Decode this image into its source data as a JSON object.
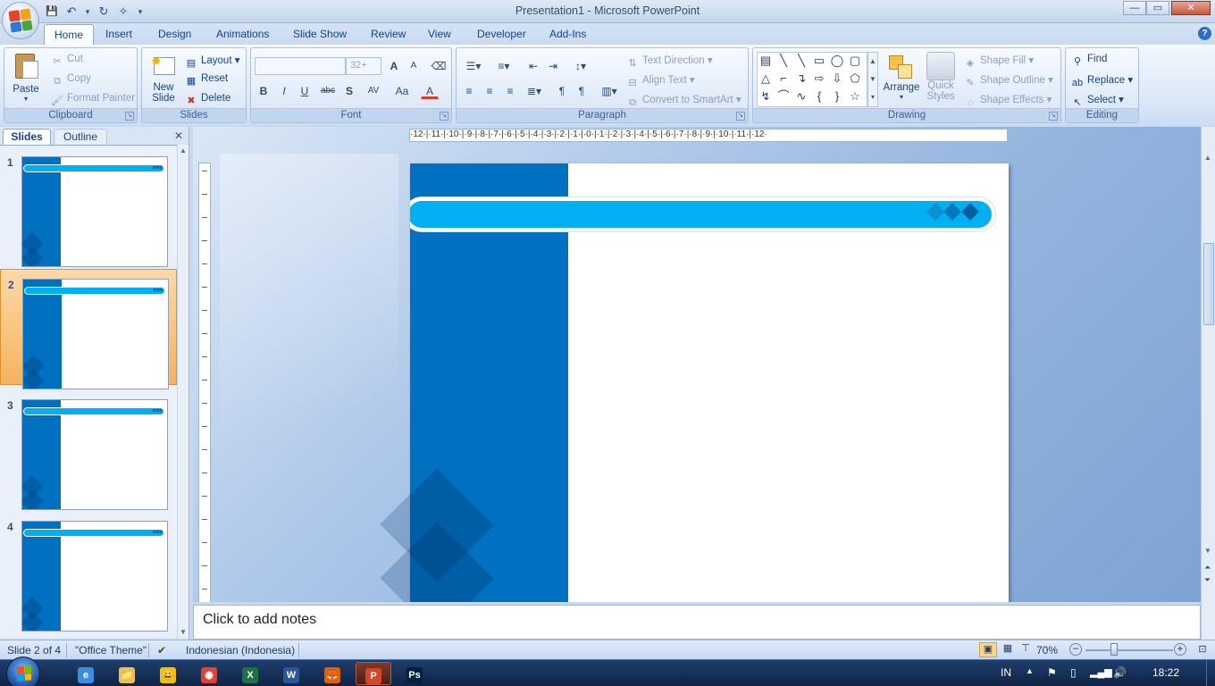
{
  "window": {
    "title": "Presentation1 - Microsoft PowerPoint",
    "minimize_glyph": "—",
    "maximize_glyph": "▭",
    "close_glyph": "✕"
  },
  "quick_access": {
    "save_glyph": "💾",
    "undo_glyph": "↶",
    "redo_glyph": "↻",
    "customize_glyph": "▾"
  },
  "tabs": [
    {
      "label": "Home",
      "active": true
    },
    {
      "label": "Insert"
    },
    {
      "label": "Design"
    },
    {
      "label": "Animations"
    },
    {
      "label": "Slide Show"
    },
    {
      "label": "Review"
    },
    {
      "label": "View"
    },
    {
      "label": "Developer"
    },
    {
      "label": "Add-Ins"
    }
  ],
  "help_glyph": "?",
  "ribbon": {
    "clipboard": {
      "label": "Clipboard",
      "paste": "Paste",
      "cut": "Cut",
      "copy": "Copy",
      "format_painter": "Format Painter"
    },
    "slides": {
      "label": "Slides",
      "new_slide_line1": "New",
      "new_slide_line2": "Slide",
      "layout": "Layout",
      "reset": "Reset",
      "delete": "Delete"
    },
    "font": {
      "label": "Font",
      "font_name": "",
      "font_size": "32+",
      "grow": "A",
      "shrink": "A",
      "bold": "B",
      "italic": "I",
      "underline": "U",
      "strike": "abc",
      "shadow": "S",
      "spacing": "AV",
      "case": "Aa",
      "color": "A"
    },
    "paragraph": {
      "label": "Paragraph",
      "text_direction": "Text Direction",
      "align_text": "Align Text",
      "convert_smartart": "Convert to SmartArt"
    },
    "drawing": {
      "label": "Drawing",
      "arrange": "Arrange",
      "quick_styles_line1": "Quick",
      "quick_styles_line2": "Styles",
      "shape_fill": "Shape Fill",
      "shape_outline": "Shape Outline",
      "shape_effects": "Shape Effects",
      "shapes": [
        "▤",
        "╲",
        "╲",
        "▭",
        "◯",
        "▢",
        "△",
        "⌐",
        "↴",
        "⇨",
        "⇩",
        "⬠",
        "↯",
        "⌒",
        "∿",
        "{",
        "}",
        "☆"
      ]
    },
    "editing": {
      "label": "Editing",
      "find": "Find",
      "replace": "Replace",
      "select": "Select"
    }
  },
  "left_panel": {
    "tab_slides": "Slides",
    "tab_outline": "Outline",
    "close_glyph": "✕",
    "slides": [
      {
        "number": "1",
        "selected": false
      },
      {
        "number": "2",
        "selected": true
      },
      {
        "number": "3",
        "selected": false
      },
      {
        "number": "4",
        "selected": false
      }
    ]
  },
  "ruler": {
    "horizontal": "·12·|·11·|·10·|·9·|·8·|·7·|·6·|·5·|·4·|·3·|·2·|·1·|·0·|·1·|·2·|·3·|·4·|·5·|·6·|·7·|·8·|·9·|·10·|·11·|·12·"
  },
  "notes": {
    "placeholder": "Click to add notes"
  },
  "status": {
    "slide_info": "Slide 2 of 4",
    "theme": "\"Office Theme\"",
    "language": "Indonesian (Indonesia)",
    "zoom": "70%",
    "zoom_level": 0.7
  },
  "taskbar": {
    "lang": "IN",
    "time": "18:22",
    "apps": [
      "e",
      "📁",
      "😀",
      "◉",
      "X",
      "W",
      "🦊",
      "P",
      "Ps"
    ]
  },
  "colors": {
    "slide_dark_blue": "#0070c0",
    "slide_light_blue": "#00b0f0",
    "selected_thumb": "#f6b35f"
  }
}
